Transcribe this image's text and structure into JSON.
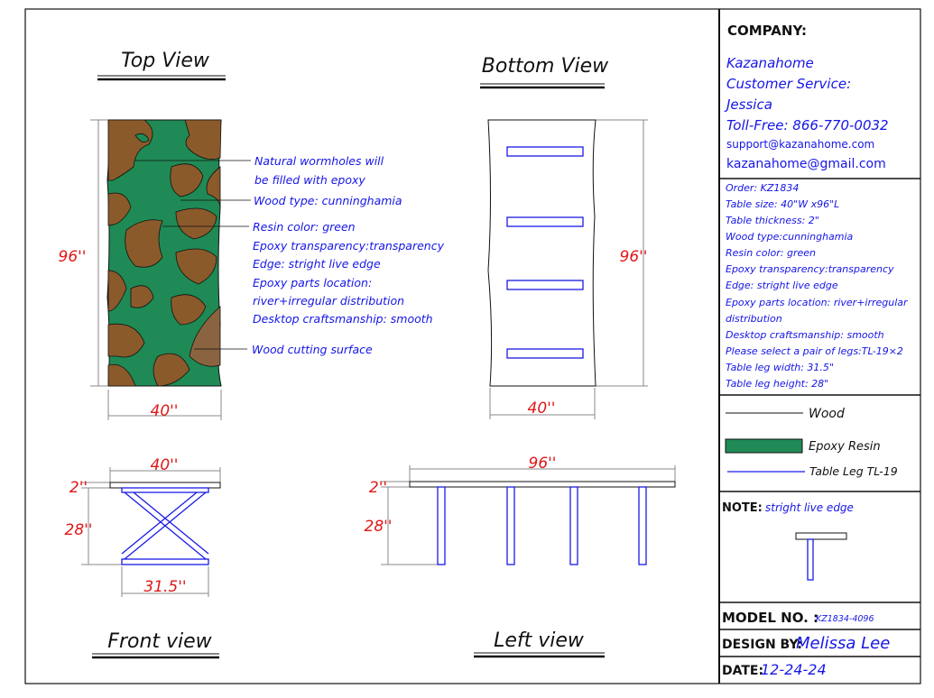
{
  "colors": {
    "wood": "#8b5a2b",
    "epoxy": "#1f8a55",
    "text": "#1515e6",
    "dimension": "#e01818"
  },
  "views": {
    "top": "Top View",
    "bottom": "Bottom View",
    "front": "Front view",
    "left": "Left view"
  },
  "top_callouts": [
    "Natural wormholes will",
    "be filled with epoxy",
    "Wood type: cunninghamia",
    "Resin color: green",
    "Epoxy transparency:transparency",
    "Edge: stright live edge",
    "Epoxy parts location:",
    " river+irregular distribution",
    "Desktop craftsmanship: smooth",
    "Wood cutting surface"
  ],
  "dims": {
    "top_len": "96''",
    "top_w": "40''",
    "bottom_len": "96''",
    "bottom_w": "40''",
    "front_w": "40''",
    "front_thick": "2''",
    "front_h": "28''",
    "front_leg": "31.5''",
    "left_len": "96''",
    "left_thick": "2''",
    "left_h": "28''"
  },
  "panel": {
    "company_label": "COMPANY:",
    "company": [
      "Kazanahome",
      "Customer Service:",
      "Jessica",
      "Toll-Free: 866-770-0032",
      "support@kazanahome.com",
      "kazanahome@gmail.com"
    ],
    "specs": [
      "Order: KZ1834",
      "Table size: 40\"W x96\"L",
      "Table thickness: 2\"",
      "Wood type:cunninghamia",
      "Resin color: green",
      "Epoxy transparency:transparency",
      "Edge: stright live edge",
      "Epoxy parts location: river+irregular",
      "distribution",
      "Desktop craftsmanship: smooth",
      "Please select a pair of legs:TL-19×2",
      "Table leg width: 31.5\"",
      "Table leg height: 28\""
    ],
    "legend": {
      "wood": "Wood",
      "epoxy": "Epoxy Resin",
      "leg": "Table Leg TL-19"
    },
    "note_label": "NOTE:",
    "note": "stright live edge",
    "model_label": "MODEL NO. :",
    "model": "KZ1834-4096",
    "design_label": "DESIGN BY:",
    "designer": "Melissa Lee",
    "date_label": "DATE:",
    "date": "12-24-24"
  }
}
